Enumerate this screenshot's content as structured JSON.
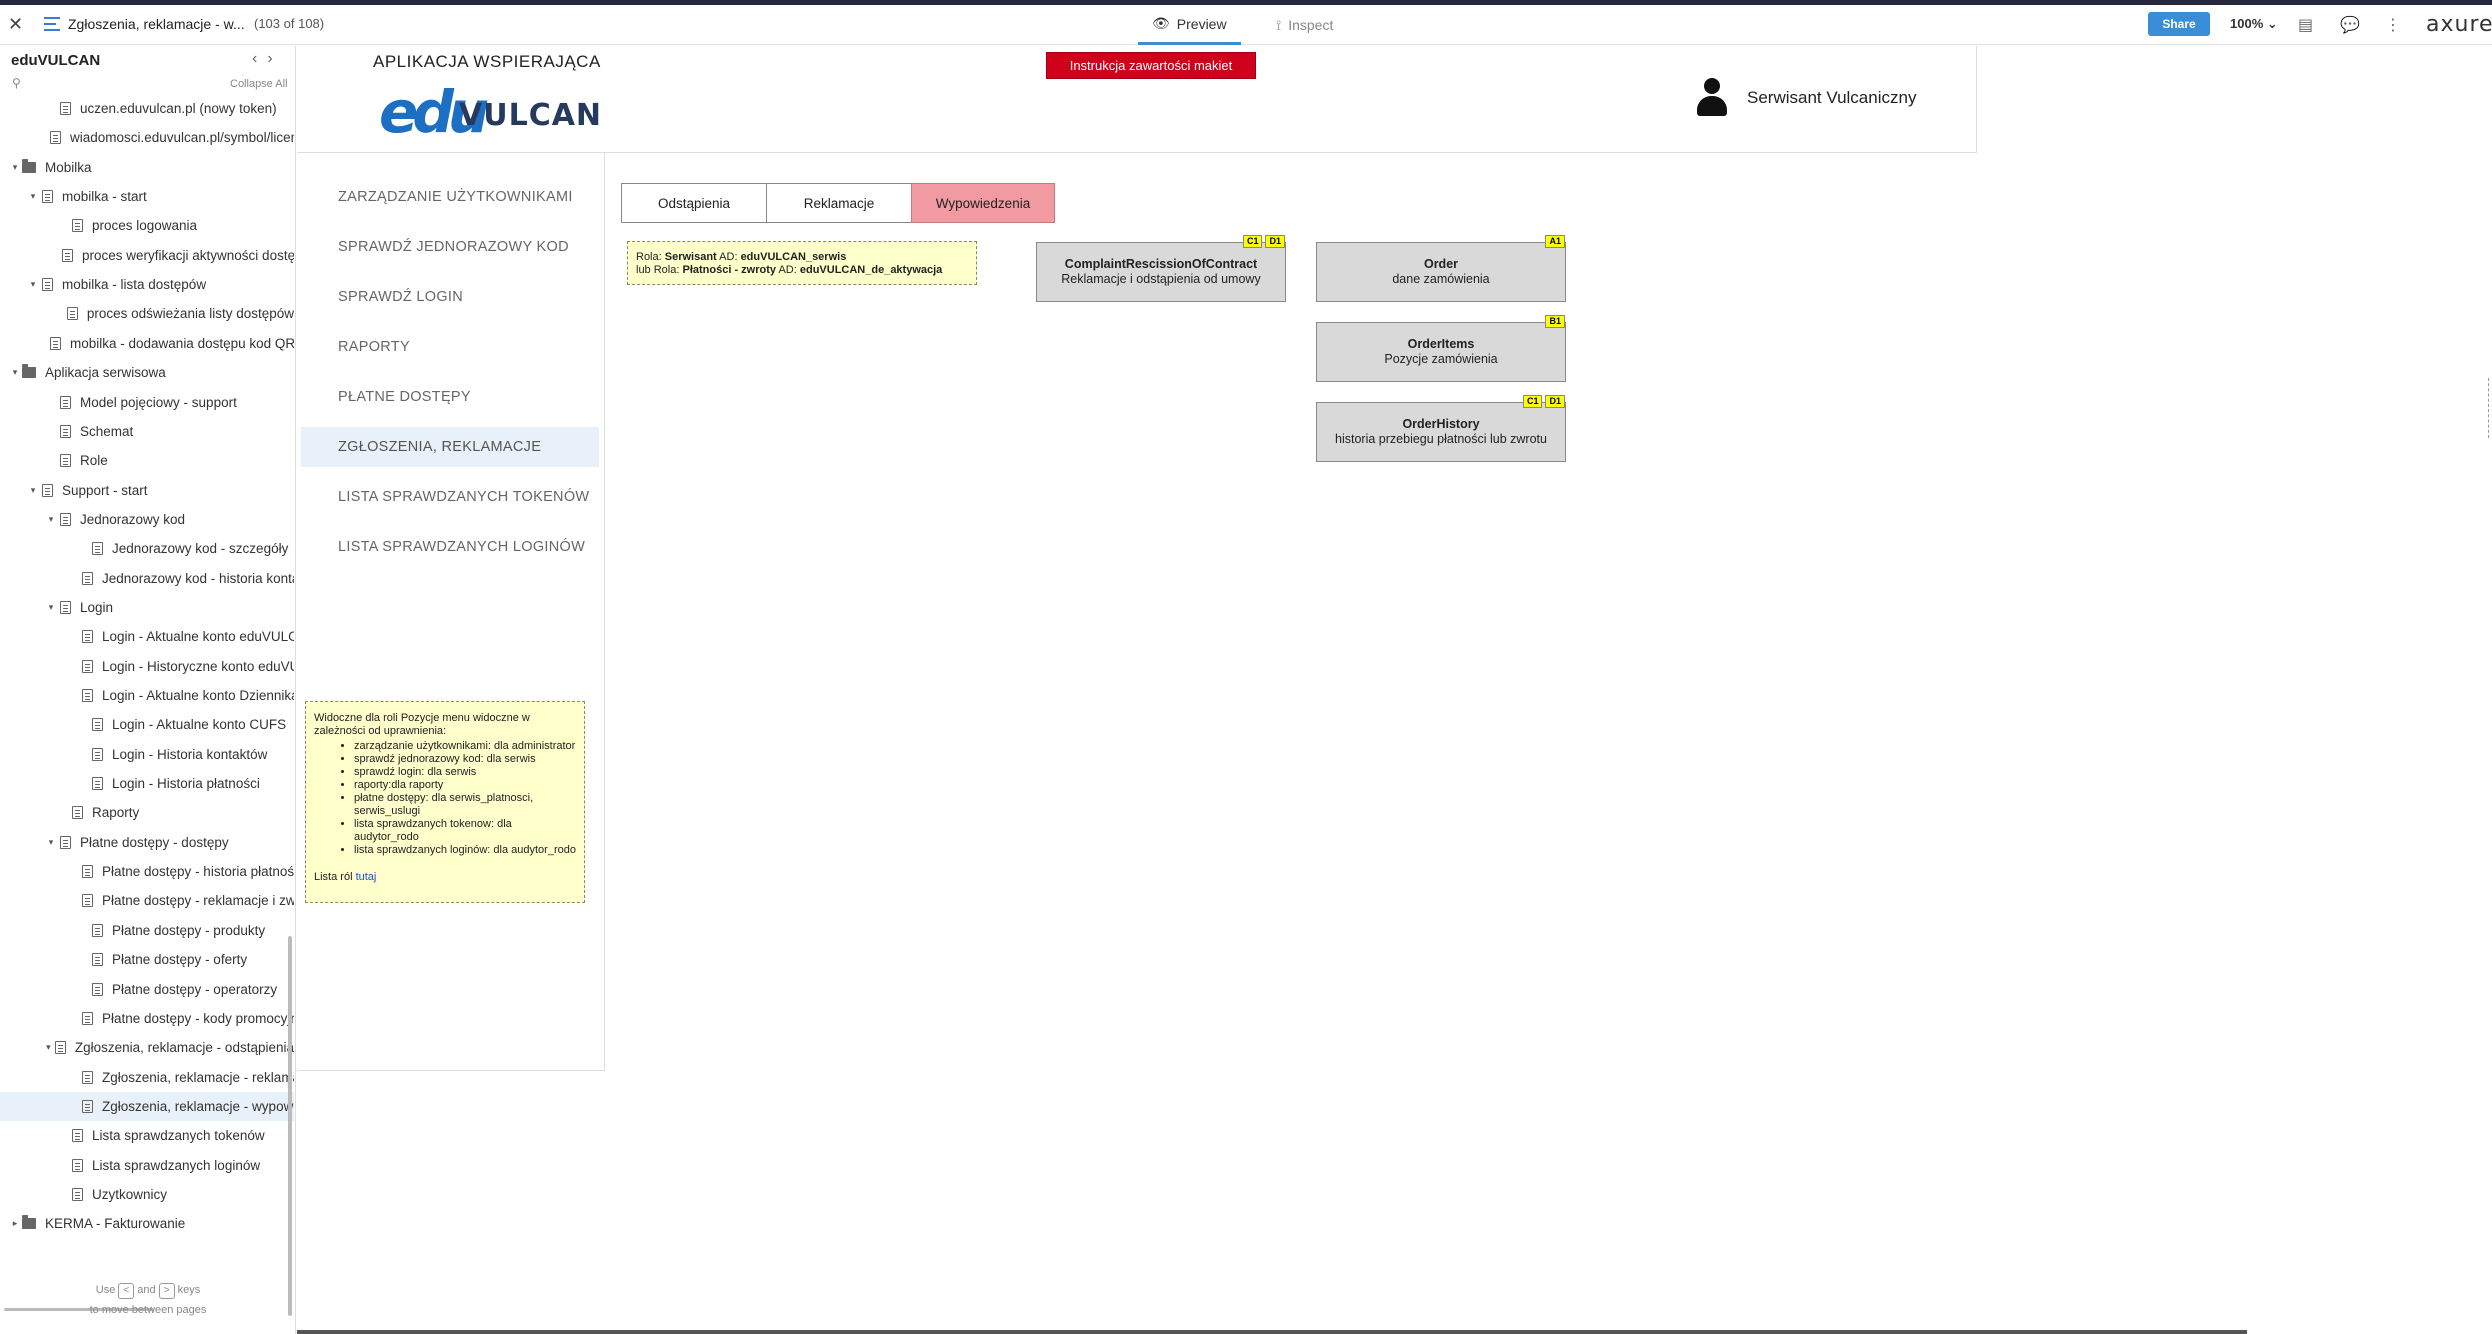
{
  "topbar": {
    "page_name": "Zgłoszenia, reklamacje - w...",
    "page_count": "(103 of 108)",
    "preview_label": "Preview",
    "inspect_label": "Inspect",
    "share_label": "Share",
    "zoom": "100%",
    "brand": "axure"
  },
  "sidebar": {
    "project": "eduVULCAN",
    "collapse_label": "Collapse All",
    "footer_use": "Use",
    "footer_and": "and",
    "footer_keys": "keys",
    "footer_move": "to move between pages",
    "key_prev": "<",
    "key_next": ">",
    "items": [
      {
        "label": "uczen.eduvulcan.pl (nowy token)",
        "type": "page",
        "indent": 2
      },
      {
        "label": "wiadomosci.eduvulcan.pl/symbol/licencja",
        "type": "page",
        "indent": 2
      },
      {
        "label": "Mobilka",
        "type": "folder",
        "indent": 0,
        "caret": "▾"
      },
      {
        "label": "mobilka - start",
        "type": "page",
        "indent": 1,
        "caret": "▾"
      },
      {
        "label": "proces logowania",
        "type": "page",
        "indent": 3
      },
      {
        "label": "proces weryfikacji aktywności dostępu",
        "type": "page",
        "indent": 3
      },
      {
        "label": "mobilka - lista dostępów",
        "type": "page",
        "indent": 1,
        "caret": "▾"
      },
      {
        "label": "proces odświeżania listy dostępów",
        "type": "page",
        "indent": 3
      },
      {
        "label": "mobilka - dodawania dostępu kod QR",
        "type": "page",
        "indent": 2
      },
      {
        "label": "Aplikacja serwisowa",
        "type": "folder",
        "indent": 0,
        "caret": "▾"
      },
      {
        "label": "Model pojęciowy - support",
        "type": "page",
        "indent": 2
      },
      {
        "label": "Schemat",
        "type": "page",
        "indent": 2
      },
      {
        "label": "Role",
        "type": "page",
        "indent": 2
      },
      {
        "label": "Support - start",
        "type": "page",
        "indent": 1,
        "caret": "▾"
      },
      {
        "label": "Jednorazowy kod",
        "type": "page",
        "indent": 2,
        "caret": "▾"
      },
      {
        "label": "Jednorazowy kod - szczegóły",
        "type": "page",
        "indent": 4
      },
      {
        "label": "Jednorazowy kod - historia kontaktów",
        "type": "page",
        "indent": 4
      },
      {
        "label": "Login",
        "type": "page",
        "indent": 2,
        "caret": "▾"
      },
      {
        "label": "Login - Aktualne konto eduVULCAN",
        "type": "page",
        "indent": 4
      },
      {
        "label": "Login - Historyczne konto eduVULCAN",
        "type": "page",
        "indent": 4
      },
      {
        "label": "Login - Aktualne konto Dziennika VULCAN",
        "type": "page",
        "indent": 4
      },
      {
        "label": "Login - Aktualne konto CUFS",
        "type": "page",
        "indent": 4
      },
      {
        "label": "Login - Historia kontaktów",
        "type": "page",
        "indent": 4
      },
      {
        "label": "Login - Historia płatności",
        "type": "page",
        "indent": 4
      },
      {
        "label": "Raporty",
        "type": "page",
        "indent": 3
      },
      {
        "label": "Płatne dostępy - dostępy",
        "type": "page",
        "indent": 2,
        "caret": "▾"
      },
      {
        "label": "Płatne dostępy - historia płatności",
        "type": "page",
        "indent": 4
      },
      {
        "label": "Płatne dostępy - reklamacje i zwroty",
        "type": "page",
        "indent": 4
      },
      {
        "label": "Płatne dostępy - produkty",
        "type": "page",
        "indent": 4
      },
      {
        "label": "Płatne dostępy - oferty",
        "type": "page",
        "indent": 4
      },
      {
        "label": "Płatne dostępy - operatorzy",
        "type": "page",
        "indent": 4
      },
      {
        "label": "Płatne dostępy - kody promocyjne",
        "type": "page",
        "indent": 4
      },
      {
        "label": "Zgłoszenia, reklamacje - odstąpienia",
        "type": "page",
        "indent": 2,
        "caret": "▾"
      },
      {
        "label": "Zgłoszenia, reklamacje - reklamacje",
        "type": "page",
        "indent": 4
      },
      {
        "label": "Zgłoszenia, reklamacje - wypowiedzenia",
        "type": "page",
        "indent": 4,
        "selected": true
      },
      {
        "label": "Lista sprawdzanych tokenów",
        "type": "page",
        "indent": 3
      },
      {
        "label": "Lista sprawdzanych loginów",
        "type": "page",
        "indent": 3
      },
      {
        "label": "Uzytkownicy",
        "type": "page",
        "indent": 3
      },
      {
        "label": "KERMA - Fakturowanie",
        "type": "folder",
        "indent": 0,
        "caret": "▸"
      }
    ]
  },
  "app": {
    "title": "APLIKACJA WSPIERAJĄCA",
    "logo_edu": "edu",
    "logo_vulcan": "VULCAN",
    "instruction_button": "Instrukcja zawartości makiet",
    "user_name": "Serwisant Vulcaniczny"
  },
  "menu": {
    "items": [
      "ZARZĄDZANIE UŻYTKOWNIKAMI",
      "SPRAWDŹ JEDNORAZOWY KOD",
      "SPRAWDŹ LOGIN",
      "RAPORTY",
      "PŁATNE DOSTĘPY",
      "ZGŁOSZENIA, REKLAMACJE",
      "LISTA SPRAWDZANYCH TOKENÓW",
      "LISTA SPRAWDZANYCH LOGINÓW"
    ],
    "active_index": 5
  },
  "menu_note": {
    "intro": "Widoczne dla roli Pozycje menu widoczne w zależności od uprawnienia:",
    "items": [
      "zarządzanie użytkownikami: dla administrator",
      "sprawdź jednorazowy kod: dla serwis",
      "sprawdź login: dla serwis",
      "raporty:dla raporty",
      "płatne dostępy: dla serwis_platnosci, serwis_uslugi",
      "lista sprawdzanych tokenow: dla audytor_rodo",
      "lista sprawdzanych loginów: dla audytor_rodo"
    ],
    "footer_text": "Lista ról ",
    "footer_link": "tutaj"
  },
  "tabs": [
    {
      "label": "Odstąpienia",
      "active": false
    },
    {
      "label": "Reklamacje",
      "active": false
    },
    {
      "label": "Wypowiedzenia",
      "active": true
    }
  ],
  "role_note": {
    "line1_prefix": "Rola: ",
    "line1_role": "Serwisant",
    "line1_ad": " AD: ",
    "line1_ad_value": "eduVULCAN_serwis",
    "line2_prefix": "lub Rola: ",
    "line2_role": "Płatności - zwroty",
    "line2_ad": " AD: ",
    "line2_ad_value": "eduVULCAN_de_aktywacja"
  },
  "entities": [
    {
      "name": "ComplaintRescissionOfContract",
      "desc": "Reklamacje i odstąpienia od umowy",
      "badges": [
        "C1",
        "D1"
      ]
    },
    {
      "name": "Order",
      "desc": "dane zamówienia",
      "badges": [
        "A1"
      ]
    },
    {
      "name": "OrderItems",
      "desc": "Pozycje zamówienia",
      "badges": [
        "B1"
      ]
    },
    {
      "name": "OrderHistory",
      "desc": "historia przebiegu płatności lub zwrotu",
      "badges": [
        "C1",
        "D1"
      ]
    }
  ],
  "colors": {
    "accent": "#3a8ed8",
    "instruction_red": "#d0021b",
    "active_tab": "#f29aa2",
    "note_yellow": "#ffffcc",
    "badge_yellow": "#ffff00",
    "entity_gray": "#d9d9d9"
  }
}
